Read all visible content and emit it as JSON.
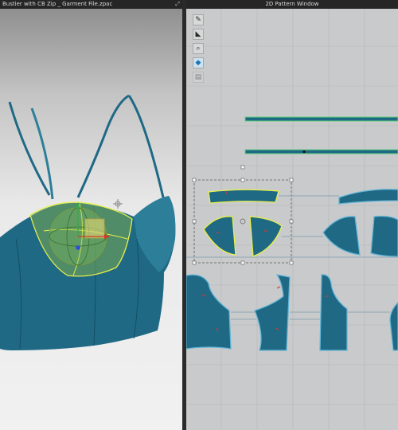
{
  "window_3d": {
    "title": "Bustier with CB Zip _ Garment File.zpac",
    "maximize_icon": "maximize-icon"
  },
  "window_2d": {
    "title": "2D Pattern Window"
  },
  "toolbar": {
    "icons": [
      "brush-tool-icon",
      "paint-bucket-icon",
      "zoom-tool-icon",
      "pattern-fill-icon",
      "layer-tool-icon"
    ]
  },
  "colors": {
    "fabric": "#1f6985",
    "fabric_light": "#2d7f99",
    "outline_selected": "#e7f04a",
    "outline_default": "#64b6d8",
    "pattern_bg": "#c9cacb",
    "viewport_top": "#8a8a8a"
  }
}
